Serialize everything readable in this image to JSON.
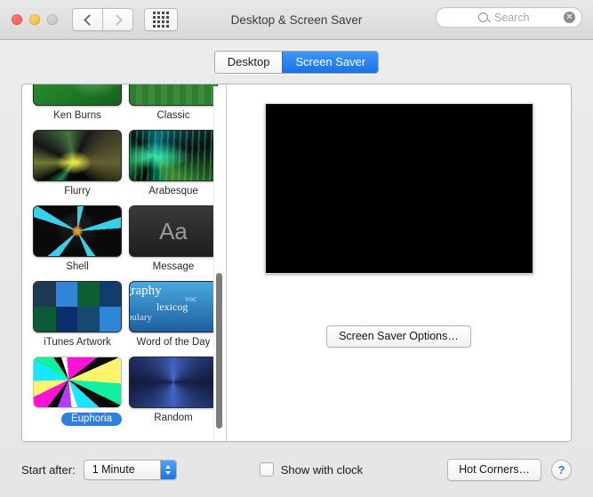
{
  "window": {
    "title": "Desktop & Screen Saver",
    "traffic_lights": [
      "close",
      "minimize",
      "zoom"
    ],
    "nav": {
      "back_icon": "chevron-left-icon",
      "forward_icon": "chevron-right-icon",
      "grid_icon": "grid-dots-icon"
    }
  },
  "search": {
    "placeholder": "Search",
    "value": "",
    "icon": "search-icon",
    "clear_glyph": "✕"
  },
  "tabs": [
    {
      "label": "Desktop",
      "active": false
    },
    {
      "label": "Screen Saver",
      "active": true
    }
  ],
  "screensavers": [
    {
      "name": "Ken Burns",
      "art": "t-kenburns",
      "selected": false
    },
    {
      "name": "Classic",
      "art": "t-classic",
      "selected": false
    },
    {
      "name": "Flurry",
      "art": "t-flurry",
      "selected": false
    },
    {
      "name": "Arabesque",
      "art": "t-arabesque",
      "selected": false
    },
    {
      "name": "Shell",
      "art": "t-shell",
      "selected": false
    },
    {
      "name": "Message",
      "art": "t-message",
      "selected": false,
      "glyph": "Aa"
    },
    {
      "name": "iTunes Artwork",
      "art": "t-itunes",
      "selected": false
    },
    {
      "name": "Word of the Day",
      "art": "t-wotd",
      "selected": false
    },
    {
      "name": "Euphoria",
      "art": "t-euphoria",
      "selected": true
    },
    {
      "name": "Random",
      "art": "t-random",
      "selected": false
    }
  ],
  "wotd_words": [
    "graphy",
    "voc",
    "lexicog",
    "abulary"
  ],
  "preview": {
    "screensaver": "Euphoria"
  },
  "options_button": {
    "label": "Screen Saver Options…"
  },
  "bottom": {
    "start_after_label": "Start after:",
    "start_after_value": "1 Minute",
    "show_clock_label": "Show with clock",
    "show_clock_checked": false,
    "hot_corners_label": "Hot Corners…",
    "help_label": "?"
  },
  "colors": {
    "accent_blue": "#1a73e8",
    "selection_blue": "#2f7fe0",
    "window_bg": "#ececec",
    "pane_bg": "#ffffff"
  }
}
